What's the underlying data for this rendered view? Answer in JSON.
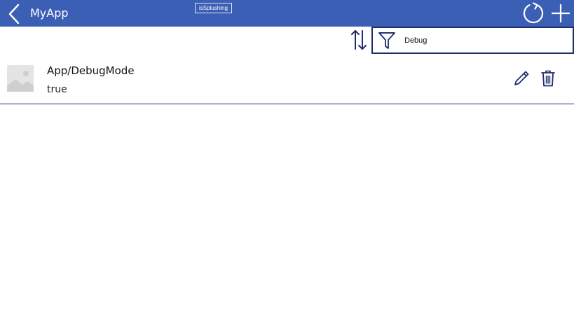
{
  "header": {
    "title": "MyApp",
    "back_icon": "chevron-left-icon",
    "refresh_icon": "refresh-icon",
    "add_icon": "plus-icon",
    "background_color": "#3a5fb4"
  },
  "debug_badge": "isSplushing",
  "toolbar": {
    "sort_icon": "sort-arrows-icon",
    "filter_icon": "filter-icon",
    "filter_value": "Debug",
    "accent_color": "#1f2d6d"
  },
  "items": [
    {
      "name": "App/DebugMode",
      "value": "true",
      "thumbnail_icon": "image-placeholder-icon",
      "edit_icon": "pencil-icon",
      "delete_icon": "trash-icon"
    }
  ]
}
